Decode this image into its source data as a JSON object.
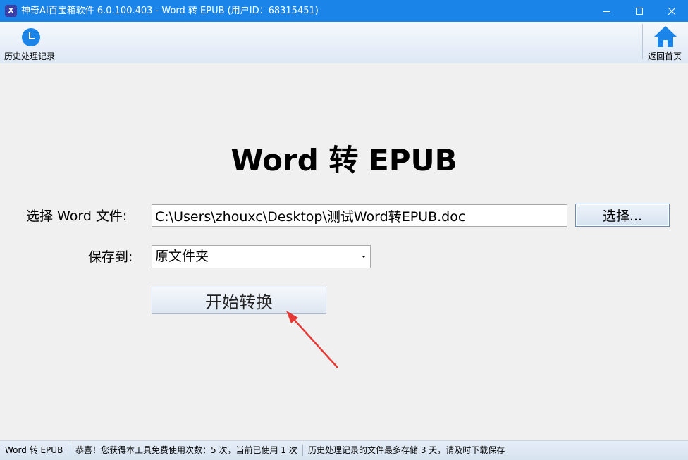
{
  "window": {
    "title": "神奇AI百宝箱软件 6.0.100.403 - Word 转 EPUB (用户ID：68315451)",
    "icon_text": "X",
    "icons": {
      "app": "app-logo-icon",
      "minimize": "minimize-icon",
      "maximize": "maximize-icon",
      "close": "close-icon"
    }
  },
  "toolbar": {
    "history_label": "历史处理记录",
    "history_icon": "clock-icon",
    "home_label": "返回首页",
    "home_icon": "home-icon",
    "accent_color": "#1a84e8"
  },
  "main": {
    "title": "Word 转 EPUB",
    "file_label": "选择 Word 文件:",
    "file_value": "C:\\Users\\zhouxc\\Desktop\\测试Word转EPUB.doc",
    "choose_button": "选择...",
    "save_label": "保存到:",
    "save_value": "原文件夹",
    "start_button": "开始转换",
    "annotation_color": "#e53935"
  },
  "status": {
    "tool_name": "Word 转 EPUB",
    "usage": "恭喜！您获得本工具免费使用次数：5 次，当前已使用 1 次",
    "note": "历史处理记录的文件最多存储 3 天，请及时下载保存"
  }
}
